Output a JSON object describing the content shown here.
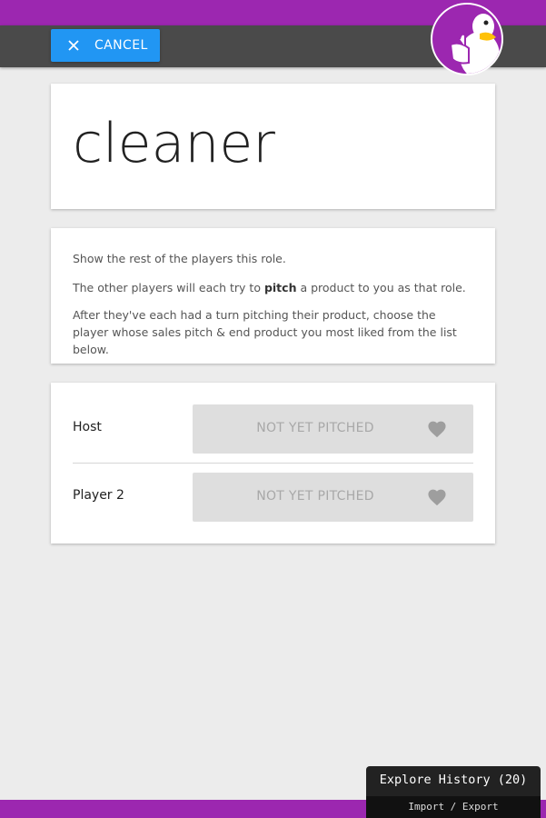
{
  "toolbar": {
    "cancel_label": "CANCEL",
    "cancel_icon": "close-icon"
  },
  "colors": {
    "brand": "#9c27b0",
    "accent": "#2196f3",
    "toolbar": "#4a4a4a"
  },
  "role": {
    "title": "cleaner"
  },
  "instructions": {
    "line1": "Show the rest of the players this role.",
    "line2_before": "The other players will each try to ",
    "line2_bold": "pitch",
    "line2_after": " a product to you as that role.",
    "line3": "After they've each had a turn pitching their product, choose the player whose sales pitch & end product you most liked from the list below."
  },
  "players": [
    {
      "name": "Host",
      "status": "NOT YET PITCHED",
      "icon": "heart-icon"
    },
    {
      "name": "Player 2",
      "status": "NOT YET PITCHED",
      "icon": "heart-icon"
    }
  ],
  "history": {
    "title": "Explore History (20)",
    "import_export": "Import / Export"
  }
}
